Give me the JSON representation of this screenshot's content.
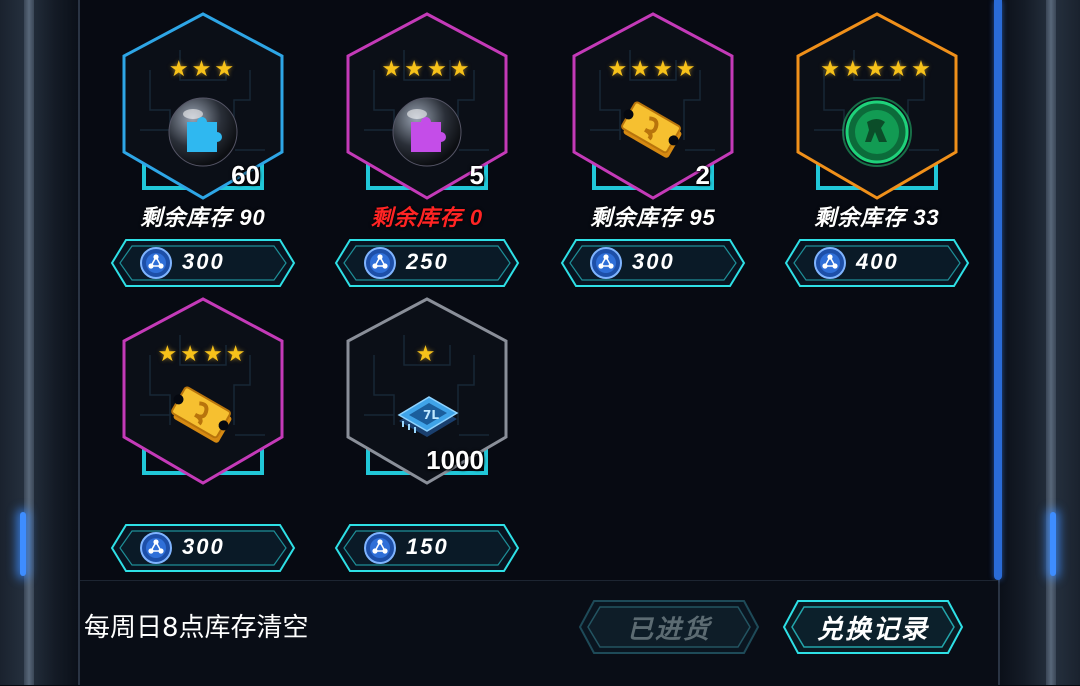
{
  "items": [
    {
      "stars": "★★★",
      "frame_color": "#2ea6e6",
      "image": "blue-puzzle-orb-icon",
      "quantity": "60",
      "stock_label": "剩余库存 90",
      "stock_out": false,
      "price": "300"
    },
    {
      "stars": "★★★★",
      "frame_color": "#c43ab8",
      "image": "purple-puzzle-orb-icon",
      "quantity": "5",
      "stock_label": "剩余库存 0",
      "stock_out": true,
      "price": "250"
    },
    {
      "stars": "★★★★",
      "frame_color": "#c43ab8",
      "image": "gold-ticket-icon",
      "quantity": "2",
      "stock_label": "剩余库存 95",
      "stock_out": false,
      "price": "300"
    },
    {
      "stars": "★★★★★",
      "frame_color": "#f0901a",
      "image": "green-medal-icon",
      "quantity": "",
      "stock_label": "剩余库存 33",
      "stock_out": false,
      "price": "400"
    },
    {
      "stars": "★★★★",
      "frame_color": "#c43ab8",
      "image": "gold-ticket-icon",
      "quantity": "",
      "stock_label": "",
      "stock_out": false,
      "price": "300"
    },
    {
      "stars": "★",
      "frame_color": "#8a8f99",
      "image": "blue-chip-icon",
      "quantity": "1000",
      "stock_label": "",
      "stock_out": false,
      "price": "150"
    }
  ],
  "footer": {
    "reset_notice": "每周日8点库存清空",
    "restocked_label": "已进货",
    "history_label": "兑换记录"
  },
  "colors": {
    "accent_cyan": "#2ee0e6",
    "currency_blue": "#2f6fd8",
    "stock_out_red": "#ff2424"
  }
}
